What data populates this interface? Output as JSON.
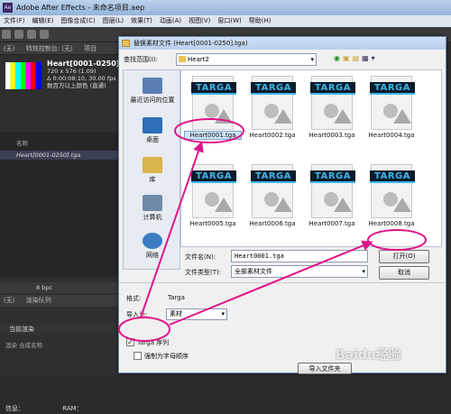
{
  "app": {
    "title": "Adobe After Effects - 未命名项目.aep",
    "logo": "Ae",
    "menu": [
      "文件(F)",
      "编辑(E)",
      "图像合成(C)",
      "图层(L)",
      "效果(T)",
      "动画(A)",
      "视图(V)",
      "窗口(W)",
      "帮助(H)"
    ]
  },
  "left_panel": {
    "tabs": [
      "(无)",
      "特效控制台: (无)",
      "项目"
    ],
    "footage": {
      "name": "Heart[0001-0250].tga",
      "dims": "720 x 576 (1.09)",
      "duration": "Δ 0:00:08:10, 30.00 fps",
      "extra": "数百万以上颜色 (直通)"
    },
    "col_header": "名称",
    "project_row": "Heart[0001-0250].tga",
    "bpc": "8 bpc",
    "bottom_tabs": [
      "(无)",
      "渲染队列"
    ],
    "current_render": "当前渲染",
    "render_cols": "渲染    合成名称",
    "info_label": "信息：",
    "ram_label": "RAM："
  },
  "dialog": {
    "title": "替换素材文件 (Heart[0001-0250].tga)",
    "look_in_label": "查找范围(I):",
    "look_in_value": "Heart2",
    "nav_icons": [
      "back-icon",
      "up-folder-icon",
      "new-folder-icon",
      "view-menu-icon"
    ],
    "places": [
      {
        "label": "最近访问的位置",
        "icon": "recent-places-icon",
        "color": "#5b7fb4"
      },
      {
        "label": "桌面",
        "icon": "desktop-icon",
        "color": "#2d6fb8"
      },
      {
        "label": "库",
        "icon": "libraries-icon",
        "color": "#d9b44a"
      },
      {
        "label": "计算机",
        "icon": "computer-icon",
        "color": "#6f8aa8"
      },
      {
        "label": "网络",
        "icon": "network-icon",
        "color": "#3d7cc2"
      }
    ],
    "files": [
      {
        "name": "Heart0001.tga",
        "badge": "TARGA",
        "selected": true
      },
      {
        "name": "Heart0002.tga",
        "badge": "TARGA",
        "selected": false
      },
      {
        "name": "Heart0003.tga",
        "badge": "TARGA",
        "selected": false
      },
      {
        "name": "Heart0004.tga",
        "badge": "TARGA",
        "selected": false
      },
      {
        "name": "Heart0005.tga",
        "badge": "TARGA",
        "selected": false
      },
      {
        "name": "Heart0006.tga",
        "badge": "TARGA",
        "selected": false
      },
      {
        "name": "Heart0007.tga",
        "badge": "TARGA",
        "selected": false
      },
      {
        "name": "Heart0008.tga",
        "badge": "TARGA",
        "selected": false
      }
    ],
    "filename_label": "文件名(N):",
    "filename_value": "Heart0001.tga",
    "filetype_label": "文件类型(T):",
    "filetype_value": "全部素材文件",
    "open_button": "打开(O)",
    "cancel_button": "取消",
    "format_label": "格式:",
    "format_value": "Targa",
    "import_as_label": "导入为:",
    "import_as_value": "素材",
    "targa_seq_label": "Targa 序列",
    "targa_seq_checked": true,
    "force_alpha_label": "强制为字母顺序",
    "force_alpha_checked": false,
    "import_folder_button": "导入文件夹"
  },
  "annotation": {
    "color": "#e0158a",
    "watermark": "Baidu经验"
  }
}
